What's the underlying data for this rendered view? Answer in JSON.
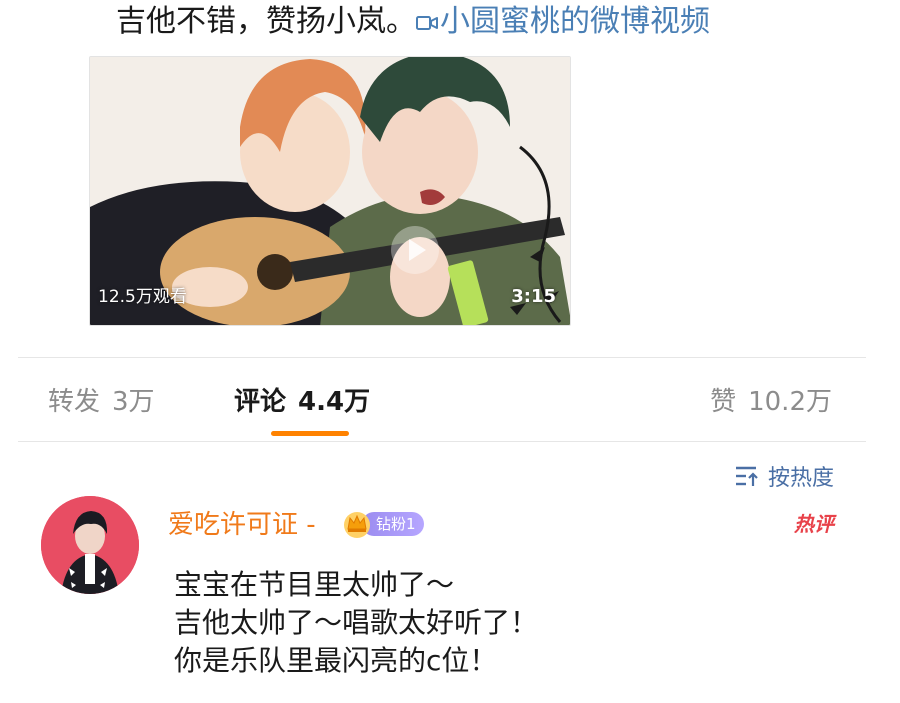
{
  "post": {
    "text": "吉他不错，赞扬小岚。",
    "video_link_label": "小圆蜜桃的微博视频"
  },
  "video": {
    "view_count": "12.5万观看",
    "duration": "3:15"
  },
  "tabs": {
    "repost_label": "转发",
    "repost_count": "3万",
    "comments_label": "评论",
    "comments_count": "4.4万",
    "likes_label": "赞",
    "likes_count": "10.2万"
  },
  "sort": {
    "label": "按热度"
  },
  "comment": {
    "username": "爱吃许可证 -",
    "fan_badge": "钻粉1",
    "hot_badge": "热评",
    "lines": [
      "宝宝在节目里太帅了～",
      "吉他太帅了～唱歌太好听了！",
      "你是乐队里最闪亮的c位！"
    ]
  },
  "colors": {
    "accent_orange": "#ff8200",
    "link_blue": "#4a7fb5",
    "username_orange": "#f07a1a",
    "hot_red": "#e8424a"
  }
}
